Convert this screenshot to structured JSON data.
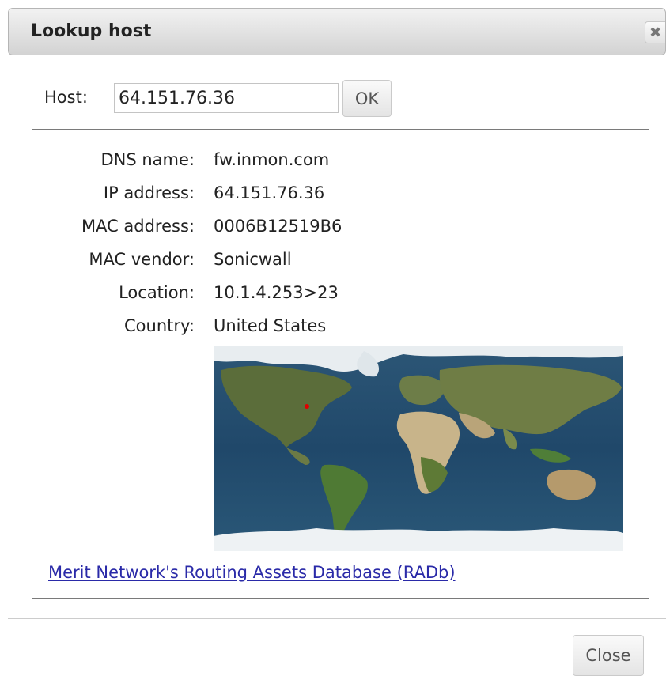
{
  "dialog": {
    "title": "Lookup host",
    "close_icon": "close-icon"
  },
  "host_form": {
    "label": "Host:",
    "value": "64.151.76.36",
    "ok_label": "OK"
  },
  "details": [
    {
      "label": "DNS name:",
      "value": "fw.inmon.com"
    },
    {
      "label": "IP address:",
      "value": "64.151.76.36"
    },
    {
      "label": "MAC address:",
      "value": "0006B12519B6"
    },
    {
      "label": "MAC vendor:",
      "value": "Sonicwall"
    },
    {
      "label": "Location:",
      "value": "10.1.4.253>23"
    },
    {
      "label": "Country:",
      "value": "United States"
    }
  ],
  "map": {
    "marker_color": "#e00000",
    "ocean_color": "#234e6e",
    "land_color": "#5f7d3a"
  },
  "radb_link": "Merit Network's Routing Assets Database (RADb)",
  "footer": {
    "close_label": "Close"
  }
}
